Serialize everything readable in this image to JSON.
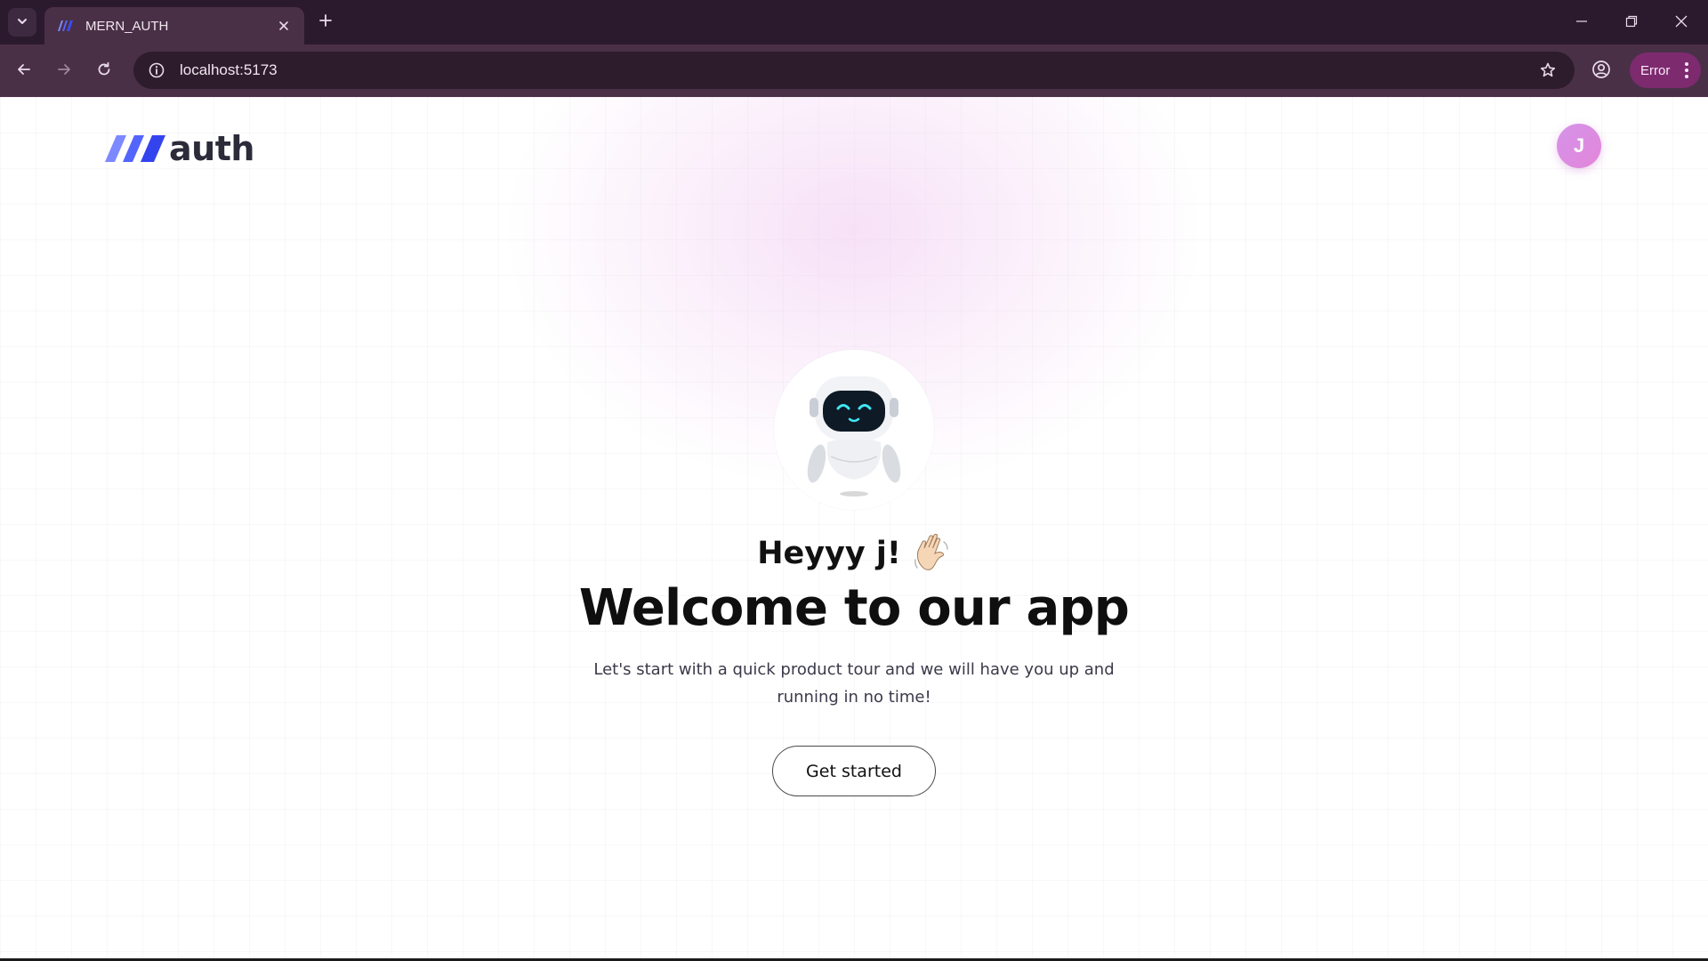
{
  "browser": {
    "tab_title": "MERN_AUTH",
    "url": "localhost:5173",
    "status_chip": "Error",
    "icons": {
      "tab_search": "chevron-down-icon",
      "tab_close": "close-icon",
      "new_tab": "plus-icon",
      "back": "arrow-left-icon",
      "forward": "arrow-right-icon",
      "reload": "reload-icon",
      "site_info": "info-icon",
      "bookmark": "star-icon",
      "profile": "profile-icon",
      "menu": "kebab-icon",
      "minimize": "minimize-icon",
      "restore": "restore-icon",
      "close": "close-icon"
    }
  },
  "app": {
    "logo_text": "auth",
    "avatar_initial": "J",
    "greeting": "Heyyy j!",
    "title": "Welcome to our app",
    "subtitle": "Let's start with a quick product tour and we will have you up and running in no time!",
    "cta_label": "Get started"
  },
  "colors": {
    "chrome_dark": "#2b1a2e",
    "chrome_toolbar": "#4a3047",
    "error_chip": "#7d2a6f",
    "avatar": "#d88fe6",
    "logo_blue": "#3b4cf0"
  }
}
